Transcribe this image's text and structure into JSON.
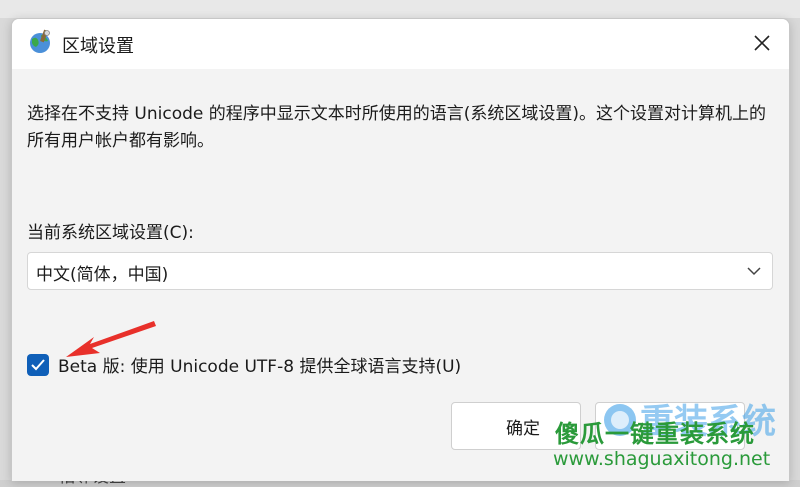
{
  "window": {
    "title": "区域设置",
    "close_glyph": "✕"
  },
  "description": "选择在不支持 Unicode 的程序中显示文本时所使用的语言(系统区域设置)。这个设置对计算机上的所有用户帐户都有影响。",
  "current_locale": {
    "label": "当前系统区域设置(C):",
    "value": "中文(简体，中国)"
  },
  "beta": {
    "label": "Beta 版: 使用 Unicode UTF-8 提供全球语言支持(U)",
    "checked": true
  },
  "buttons": {
    "ok_label": "确定"
  },
  "background": {
    "peek_text": "相邻设置"
  },
  "watermark": {
    "cn_text": "傻瓜一键重装系统",
    "url": "www.shaguaxitong.net"
  },
  "colors": {
    "accent": "#0f5fb8",
    "annotation_arrow": "#e8302a",
    "watermark_green": "#2a9a3a"
  },
  "icons": [
    "globe-icon",
    "close-icon",
    "chevron-down-icon",
    "checkmark-icon",
    "red-arrow-annotation"
  ]
}
